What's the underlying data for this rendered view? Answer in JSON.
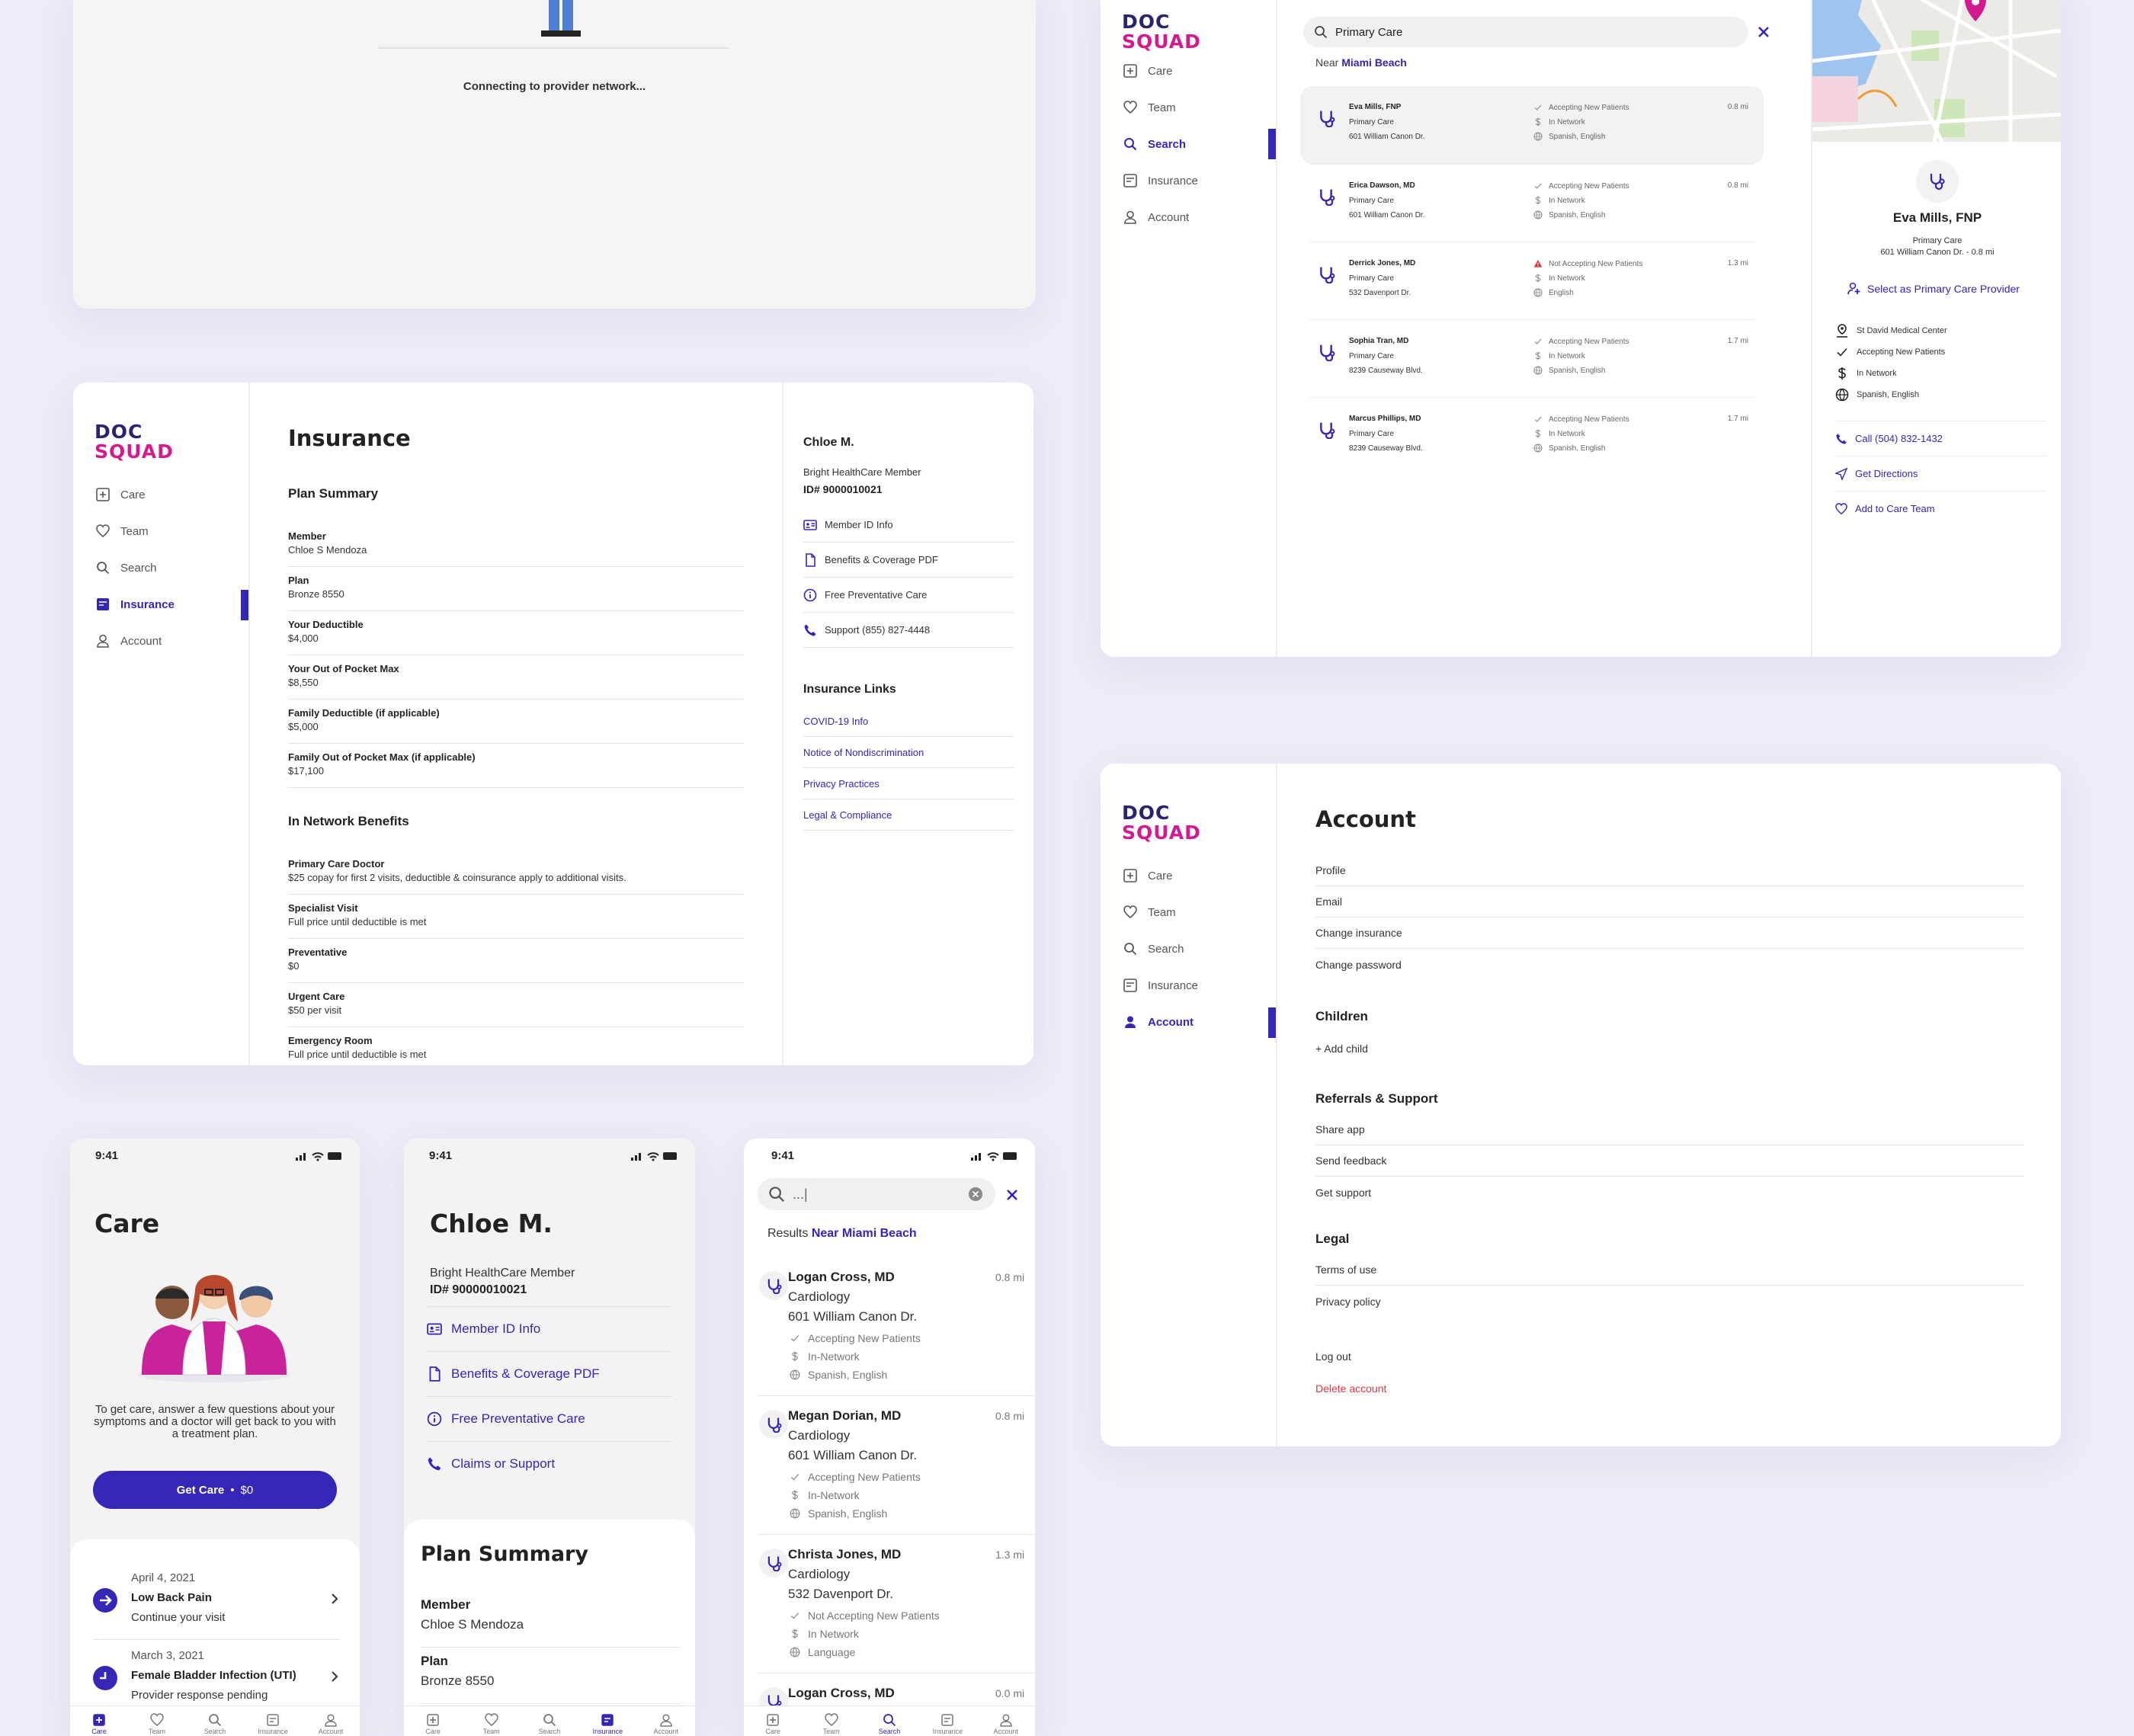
{
  "logo": {
    "line1": "DOC",
    "line2": "SQUAD"
  },
  "nav": {
    "care": "Care",
    "team": "Team",
    "search": "Search",
    "insurance": "Insurance",
    "account": "Account"
  },
  "connecting": {
    "text": "Connecting to provider network..."
  },
  "insurance": {
    "title": "Insurance",
    "plan_summary_heading": "Plan Summary",
    "plan_rows": [
      {
        "label": "Member",
        "value": "Chloe S Mendoza"
      },
      {
        "label": "Plan",
        "value": "Bronze 8550"
      },
      {
        "label": "Your Deductible",
        "value": "$4,000"
      },
      {
        "label": "Your Out of Pocket Max",
        "value": "$8,550"
      },
      {
        "label": "Family Deductible (if applicable)",
        "value": "$5,000"
      },
      {
        "label": "Family Out of Pocket Max (if applicable)",
        "value": "$17,100"
      }
    ],
    "benefits_heading": "In Network Benefits",
    "benefit_rows": [
      {
        "label": "Primary Care Doctor",
        "value": "$25 copay for first 2 visits, deductible & coinsurance apply to additional visits."
      },
      {
        "label": "Specialist Visit",
        "value": "Full price until deductible is met"
      },
      {
        "label": "Preventative",
        "value": "$0"
      },
      {
        "label": "Urgent Care",
        "value": "$50 per visit"
      },
      {
        "label": "Emergency Room",
        "value": "Full price until deductible is met"
      }
    ],
    "member_name": "Chloe M.",
    "member_type": "Bright HealthCare Member",
    "member_id": "ID# 9000010021",
    "actions": [
      "Member ID Info",
      "Benefits & Coverage PDF",
      "Free Preventative Care",
      "Support (855) 827-4448"
    ],
    "links_heading": "Insurance Links",
    "links": [
      "COVID-19 Info",
      "Notice of Nondiscrimination",
      "Privacy Practices",
      "Legal & Compliance"
    ]
  },
  "search": {
    "query": "Primary Care",
    "near_label": "Near",
    "near_location": "Miami Beach",
    "results": [
      {
        "name": "Eva Mills, FNP",
        "specialty": "Primary Care",
        "address": "601 William Canon Dr.",
        "status": "Accepting New Patients",
        "network": "In Network",
        "languages": "Spanish, English",
        "distance": "0.8 mi",
        "warn": false
      },
      {
        "name": "Erica Dawson, MD",
        "specialty": "Primary Care",
        "address": "601 William Canon Dr.",
        "status": "Accepting New Patients",
        "network": "In Network",
        "languages": "Spanish, English",
        "distance": "0.8 mi",
        "warn": false
      },
      {
        "name": "Derrick Jones, MD",
        "specialty": "Primary Care",
        "address": "532 Davenport Dr.",
        "status": "Not Accepting New Patients",
        "network": "In Network",
        "languages": "English",
        "distance": "1.3 mi",
        "warn": true
      },
      {
        "name": "Sophia Tran, MD",
        "specialty": "Primary Care",
        "address": "8239 Causeway Blvd.",
        "status": "Accepting New Patients",
        "network": "In Network",
        "languages": "Spanish, English",
        "distance": "1.7 mi",
        "warn": false
      },
      {
        "name": "Marcus Phillips, MD",
        "specialty": "Primary Care",
        "address": "8239 Causeway Blvd.",
        "status": "Accepting New Patients",
        "network": "In Network",
        "languages": "Spanish, English",
        "distance": "1.7 mi",
        "warn": false
      }
    ],
    "detail": {
      "name": "Eva Mills, FNP",
      "specialty": "Primary Care",
      "address": "601 William Canon Dr. - 0.8 mi",
      "select_label": "Select as Primary Care Provider",
      "facts": [
        "St David Medical Center",
        "Accepting New Patients",
        "In Network",
        "Spanish, English"
      ],
      "actions": [
        "Call (504) 832-1432",
        "Get Directions",
        "Add to Care Team"
      ]
    }
  },
  "account": {
    "title": "Account",
    "items": [
      "Profile",
      "Email",
      "Change insurance",
      "Change password"
    ],
    "children_heading": "Children",
    "add_child": "+ Add child",
    "referrals_heading": "Referrals & Support",
    "referral_items": [
      "Share app",
      "Send feedback",
      "Get support"
    ],
    "legal_heading": "Legal",
    "legal_items": [
      "Terms of use",
      "Privacy policy"
    ],
    "logout": "Log out",
    "delete": "Delete account"
  },
  "phone_care": {
    "time": "9:41",
    "title": "Care",
    "description": "To get care, answer a few questions about your symptoms and a doctor will get back to you with a treatment plan.",
    "button_label": "Get Care",
    "button_price": "$0",
    "visits": [
      {
        "date": "April 4, 2021",
        "title": "Low Back Pain",
        "subtitle": "Continue your visit"
      },
      {
        "date": "March 3, 2021",
        "title": "Female Bladder Infection (UTI)",
        "subtitle": "Provider response pending"
      }
    ],
    "tabs": [
      "Care",
      "Team",
      "Search",
      "Insurance",
      "Account"
    ]
  },
  "phone_insurance": {
    "time": "9:41",
    "name": "Chloe M.",
    "member_type": "Bright HealthCare Member",
    "member_id": "ID# 90000010021",
    "actions": [
      "Member ID Info",
      "Benefits & Coverage PDF",
      "Free Preventative Care",
      "Claims or Support"
    ],
    "plan_heading": "Plan Summary",
    "rows": [
      {
        "label": "Member",
        "value": "Chloe S Mendoza"
      },
      {
        "label": "Plan",
        "value": "Bronze 8550"
      }
    ]
  },
  "phone_search": {
    "time": "9:41",
    "query": "...|",
    "results_label": "Results",
    "near": "Near Miami Beach",
    "results": [
      {
        "name": "Logan Cross, MD",
        "specialty": "Cardiology",
        "address": "601 William Canon Dr.",
        "status": "Accepting New Patients",
        "network": "In-Network",
        "languages": "Spanish, English",
        "distance": "0.8 mi"
      },
      {
        "name": "Megan Dorian, MD",
        "specialty": "Cardiology",
        "address": "601 William Canon Dr.",
        "status": "Accepting New Patients",
        "network": "In-Network",
        "languages": "Spanish, English",
        "distance": "0.8 mi"
      },
      {
        "name": "Christa Jones, MD",
        "specialty": "Cardiology",
        "address": "532 Davenport Dr.",
        "status": "Not Accepting New Patients",
        "network": "In Network",
        "languages": "Language",
        "distance": "1.3 mi"
      },
      {
        "name": "Logan Cross, MD",
        "specialty": "",
        "address": "",
        "status": "",
        "network": "",
        "languages": "",
        "distance": "0.0 mi"
      }
    ]
  },
  "colors": {
    "brand": "#3526b6",
    "logo_pink": "#d31a8e",
    "logo_navy": "#2a2470",
    "danger": "#e0343f"
  }
}
